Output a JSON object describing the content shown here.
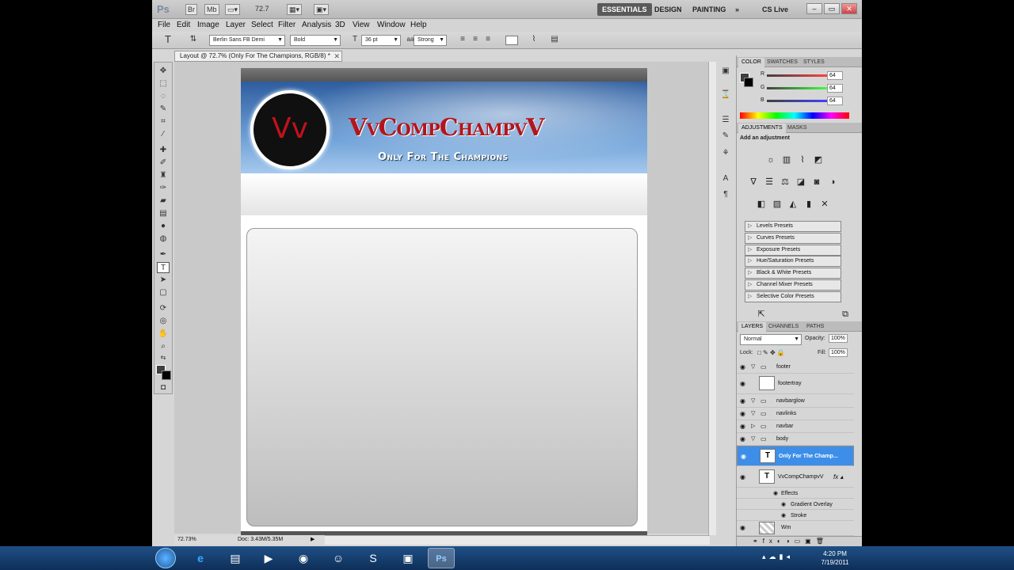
{
  "app": {
    "logo": "Ps",
    "zoom": "72.7",
    "workspaces": [
      "ESSENTIALS",
      "DESIGN",
      "PAINTING"
    ],
    "cs_live": "CS Live"
  },
  "menu": [
    "File",
    "Edit",
    "Image",
    "Layer",
    "Select",
    "Filter",
    "Analysis",
    "3D",
    "View",
    "Window",
    "Help"
  ],
  "options": {
    "font_family": "Berlin Sans FB Demi",
    "font_style": "Bold",
    "font_size": "36 pt",
    "anti_alias": "Strong"
  },
  "document": {
    "tab": "Layout @ 72.7% (Only For The Champions, RGB/8) *",
    "brand": "VvCompChampvV",
    "logo_text": "Vv",
    "slogan": "Only For The Champions"
  },
  "status": {
    "zoom": "72.73%",
    "doc": "Doc: 3.43M/5.35M"
  },
  "color_panel": {
    "tabs": [
      "COLOR",
      "SWATCHES",
      "STYLES"
    ],
    "channels": [
      {
        "label": "R",
        "value": "64"
      },
      {
        "label": "G",
        "value": "64"
      },
      {
        "label": "B",
        "value": "64"
      }
    ]
  },
  "adjustments": {
    "tabs": [
      "ADJUSTMENTS",
      "MASKS"
    ],
    "heading": "Add an adjustment",
    "presets": [
      "Levels Presets",
      "Curves Presets",
      "Exposure Presets",
      "Hue/Saturation Presets",
      "Black & White Presets",
      "Channel Mixer Presets",
      "Selective Color Presets"
    ]
  },
  "layers_panel": {
    "tabs": [
      "LAYERS",
      "CHANNELS",
      "PATHS"
    ],
    "blend_mode": "Normal",
    "opacity_label": "Opacity:",
    "opacity": "100%",
    "lock_label": "Lock:",
    "fill_label": "Fill:",
    "fill": "100%",
    "layers": [
      "footer",
      "footertray",
      "navbarglow",
      "navlinks",
      "navbar",
      "body",
      "Only For The Champ...",
      "VvCompChampvV",
      "Effects",
      "Gradient Overlay",
      "Stroke",
      "Wm"
    ]
  },
  "taskbar": {
    "time": "4:20 PM",
    "date": "7/19/2011"
  }
}
